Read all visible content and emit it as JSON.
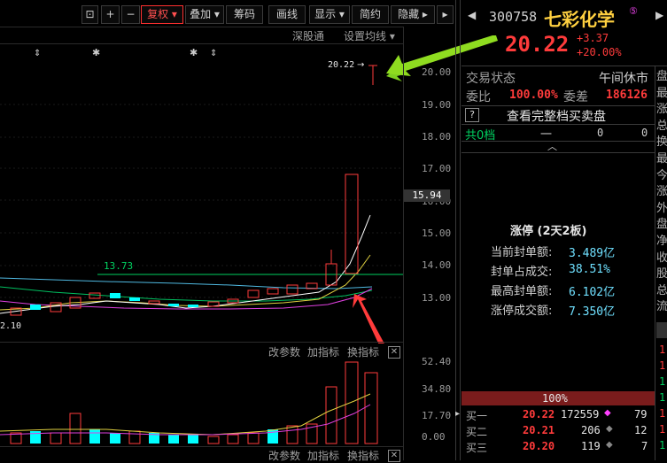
{
  "toolbar": {
    "fuquan": "复权",
    "diejia": "叠加",
    "choumа": "筹码",
    "huaxian": "画线",
    "xianshi": "显示",
    "jianyue": "简约",
    "yincang": "隐藏"
  },
  "chart_header": {
    "link1": "深股通",
    "link2": "设置均线"
  },
  "price_axis": [
    "20.00",
    "19.00",
    "18.00",
    "17.00",
    "16.00",
    "15.00",
    "14.00",
    "13.00"
  ],
  "current_price_tag": "15.94",
  "high_annotation": "20.22",
  "ma_label": "13.73",
  "low_label": "2.10",
  "sub_toolbar": {
    "params": "改参数",
    "add": "加指标",
    "switch": "换指标"
  },
  "volume_axis": [
    "52.40",
    "34.80",
    "17.70",
    "0.00"
  ],
  "stock": {
    "code": "300758",
    "name": "七彩化学",
    "price": "20.22",
    "change": "+3.37",
    "change_pct": "+20.00%"
  },
  "status": {
    "label": "交易状态",
    "value": "午间休市"
  },
  "ratio": {
    "label1": "委比",
    "value1": "100.00%",
    "label2": "委差",
    "value2": "186126"
  },
  "full_book_button": "查看完整档买卖盘",
  "total_level": {
    "label": "共0档",
    "dash": "一",
    "v1": "0",
    "v2": "0"
  },
  "limit_up": {
    "title": "涨停 (2天2板)",
    "items": [
      {
        "label": "当前封单额:",
        "value": "3.489亿"
      },
      {
        "label": "封单占成交:",
        "value": "38.51%"
      },
      {
        "label": "最高封单额:",
        "value": "6.102亿"
      },
      {
        "label": "涨停成交额:",
        "value": "7.350亿"
      }
    ]
  },
  "strength": "100%",
  "bids": [
    {
      "label": "买一",
      "price": "20.22",
      "vol": "172559",
      "extra": "79"
    },
    {
      "label": "买二",
      "price": "20.21",
      "vol": "206",
      "extra": "12"
    },
    {
      "label": "买三",
      "price": "20.20",
      "vol": "119",
      "extra": "7"
    }
  ],
  "side_chars": [
    "盘",
    "最",
    "涨",
    "总",
    "换",
    "最",
    "今",
    "涨",
    "外",
    "盘",
    "净",
    "收",
    "股",
    "总",
    "流"
  ],
  "colors": {
    "up": "#ff3b3b",
    "down": "#00ffff",
    "accent": "#ffd040"
  }
}
